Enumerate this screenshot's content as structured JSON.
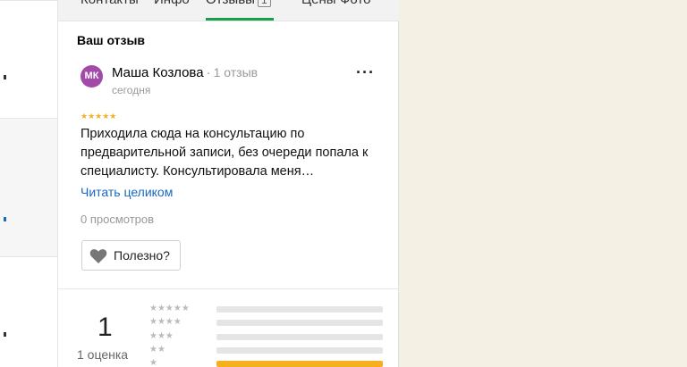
{
  "tabs": [
    {
      "label": "Контакты"
    },
    {
      "label": "Инфо"
    },
    {
      "label": "Отзывы",
      "count": "1",
      "active": true
    },
    {
      "label": "Цены"
    },
    {
      "label": "Фото"
    }
  ],
  "review_section": {
    "heading": "Ваш отзыв",
    "avatar_initials": "МК",
    "avatar_color": "#a349a9",
    "author": "Маша Козлова",
    "author_reviews": "1 отзыв",
    "date": "сегодня",
    "rating_stars": "★★★★★",
    "text": "Приходила сюда на консультацию по предварительной записи, без очереди попала к специалисту. Консультировала меня…",
    "read_more": "Читать целиком",
    "views": "0 просмотров",
    "useful_label": "Полезно?",
    "more_icon": "more-dots-icon"
  },
  "summary": {
    "rating": "1",
    "ratings_count": "1 оценка",
    "distribution": [
      {
        "stars": "★★★★★",
        "fraction": 0
      },
      {
        "stars": "★★★★",
        "fraction": 0
      },
      {
        "stars": "★★★",
        "fraction": 0
      },
      {
        "stars": "★★",
        "fraction": 0
      },
      {
        "stars": "★",
        "fraction": 1
      }
    ]
  },
  "colors": {
    "accent_green": "#15a14a",
    "star_yellow": "#f6b01e",
    "link_blue": "#1868c4",
    "background": "#f4f0e4"
  }
}
